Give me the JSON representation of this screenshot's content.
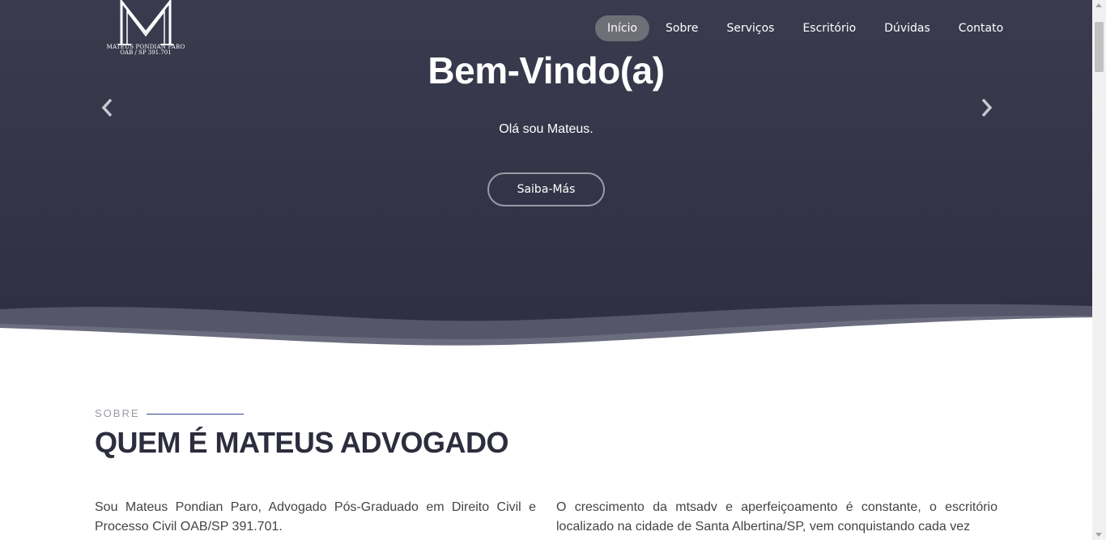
{
  "logo": {
    "line1": "MATEUS PONDIAN PARO",
    "line2": "OAB / SP 391.701"
  },
  "nav": {
    "items": [
      "Início",
      "Sobre",
      "Serviços",
      "Escritório",
      "Dúvidas",
      "Contato"
    ],
    "active": "Início"
  },
  "hero": {
    "title": "Bem-Vindo(a)",
    "subtitle": "Olá sou Mateus.",
    "button": "Saiba-Más",
    "prev_icon": "chevron-left-icon",
    "next_icon": "chevron-right-icon"
  },
  "about": {
    "label": "SOBRE",
    "title": "QUEM É MATEUS ADVOGADO",
    "para_left": "Sou Mateus Pondian Paro, Advogado Pós-Graduado em Direito Civil e Processo Civil OAB/SP 391.701.",
    "para_right": "O crescimento da mtsadv e aperfeiçoamento é constante, o escritório localizado na cidade de Santa Albertina/SP, vem conquistando cada vez"
  },
  "colors": {
    "hero_bg": "#2e2f42",
    "active_nav": "#6f6f78",
    "accent_line": "#3b3f8f",
    "heading": "#2c2d3d"
  }
}
